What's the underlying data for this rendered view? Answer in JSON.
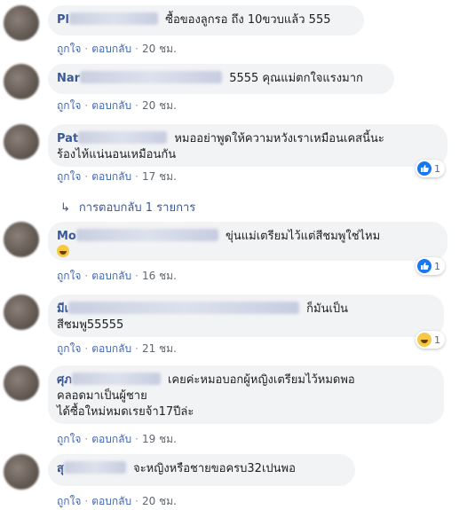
{
  "comments": [
    {
      "name": "Pl",
      "text": "ซื้อของลูกรอ ถึง 10ขวบแล้ว 555",
      "time": "20 ชม.",
      "reaction": null
    },
    {
      "name": "Nar",
      "text": "5555 คุณแม่ตกใจแรงมาก",
      "time": "20 ชม.",
      "reaction": null
    },
    {
      "name": "Pat",
      "text_l1": "หมออย่าพูดให้ความหวังเราเหมือนเคสนี้นะ",
      "text_l2": "ร้องไห้แน่นอนเหมือนกัน",
      "time": "17 ชม.",
      "reaction": {
        "type": "like",
        "count": "1"
      }
    },
    {
      "name": "Mo",
      "text_l1": "ขุ่นแม่เตรียมไว้แต่สีชมพูใช่ไหม",
      "time": "16 ชม.",
      "reaction": {
        "type": "like",
        "count": "1"
      }
    },
    {
      "name": "มีเ",
      "text_l1": "ก็มันเป็น",
      "text_l2": "สีชมพู55555",
      "time": "21 ชม.",
      "reaction": {
        "type": "haha",
        "count": "1"
      }
    },
    {
      "name": "ศุภ",
      "text_l1": "เคยค่ะหมอบอกผู้หญิงเตรียมไว้หมดพอ",
      "text_l2": "คลอดมาเป็นผู้ชาย",
      "text_l3": "ได้ซื้อใหม่หมดเรยจ้า17ปีล่ะ",
      "time": "19 ชม.",
      "reaction": null
    },
    {
      "name": "สุ",
      "text": "จะหญิงหรือชายขอครบ32เปนพอ",
      "time": "20 ชม.",
      "reaction": null
    }
  ],
  "actions": {
    "like": "ถูกใจ",
    "reply": "ตอบกลับ",
    "dot": "·"
  },
  "replies_label": "การตอบกลับ 1 รายการ",
  "replies_arrow": "↳",
  "colors": {
    "name": "#385898",
    "link": "#4267b2",
    "bubble": "#f2f3f5",
    "like": "#1877f2"
  }
}
